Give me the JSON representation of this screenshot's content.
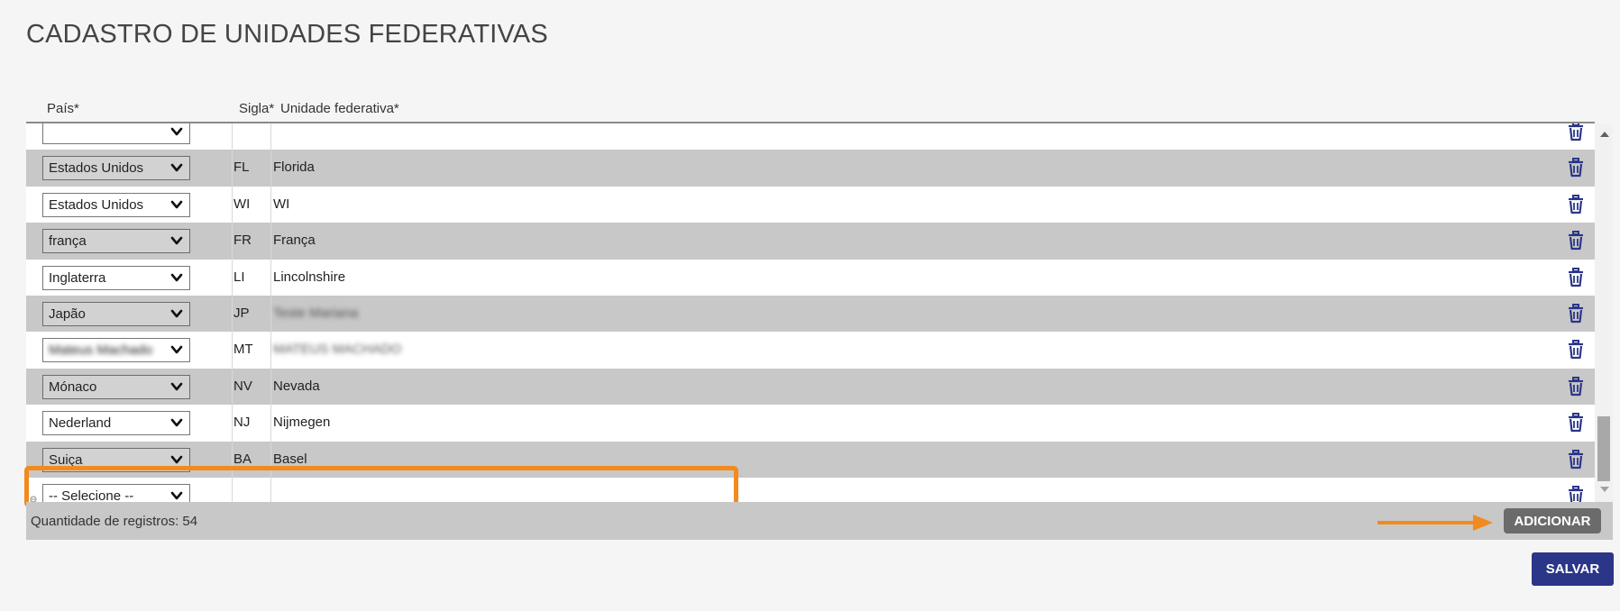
{
  "page": {
    "title": "CADASTRO DE UNIDADES FEDERATIVAS"
  },
  "columns": {
    "pais": "País*",
    "sigla": "Sigla*",
    "uf": "Unidade federativa*"
  },
  "rows": [
    {
      "pais": "",
      "sigla": "",
      "uf": "",
      "style": "white",
      "blurred": false,
      "partial": true
    },
    {
      "pais": "Estados Unidos",
      "sigla": "FL",
      "uf": "Florida",
      "style": "gray",
      "blurred": false
    },
    {
      "pais": "Estados Unidos",
      "sigla": "WI",
      "uf": "WI",
      "style": "white",
      "blurred": false
    },
    {
      "pais": "frança",
      "sigla": "FR",
      "uf": "França",
      "style": "gray",
      "blurred": false
    },
    {
      "pais": "Inglaterra",
      "sigla": "LI",
      "uf": "Lincolnshire",
      "style": "white",
      "blurred": false
    },
    {
      "pais": "Japão",
      "sigla": "JP",
      "uf": "Teste Mariana",
      "style": "gray",
      "blurred_uf": true
    },
    {
      "pais": "Mateus Machado",
      "sigla": "MT",
      "uf": "MATEUS MACHADO",
      "style": "white",
      "blurred_pais": true,
      "blurred_uf": true
    },
    {
      "pais": "Mónaco",
      "sigla": "NV",
      "uf": "Nevada",
      "style": "gray",
      "blurred": false
    },
    {
      "pais": "Nederland",
      "sigla": "NJ",
      "uf": "Nijmegen",
      "style": "white",
      "blurred": false
    },
    {
      "pais": "Suiça",
      "sigla": "BA",
      "uf": "Basel",
      "style": "gray",
      "blurred": false
    },
    {
      "pais": "-- Selecione --",
      "sigla": "",
      "uf": "",
      "style": "white",
      "blurred": false,
      "new": true
    }
  ],
  "footer": {
    "record_count": "Quantidade de registros: 54"
  },
  "buttons": {
    "add": "ADICIONAR",
    "save": "SALVAR"
  },
  "icons": {
    "delete": "trash-icon",
    "dropdown": "chevron-down-icon",
    "annotation": "arrow-right-icon"
  },
  "colors": {
    "accent_orange": "#f28a1e",
    "save_blue": "#2b3688",
    "add_gray": "#6b6b6b",
    "trash_blue": "#2b3688",
    "row_gray": "#c8c8c8"
  }
}
